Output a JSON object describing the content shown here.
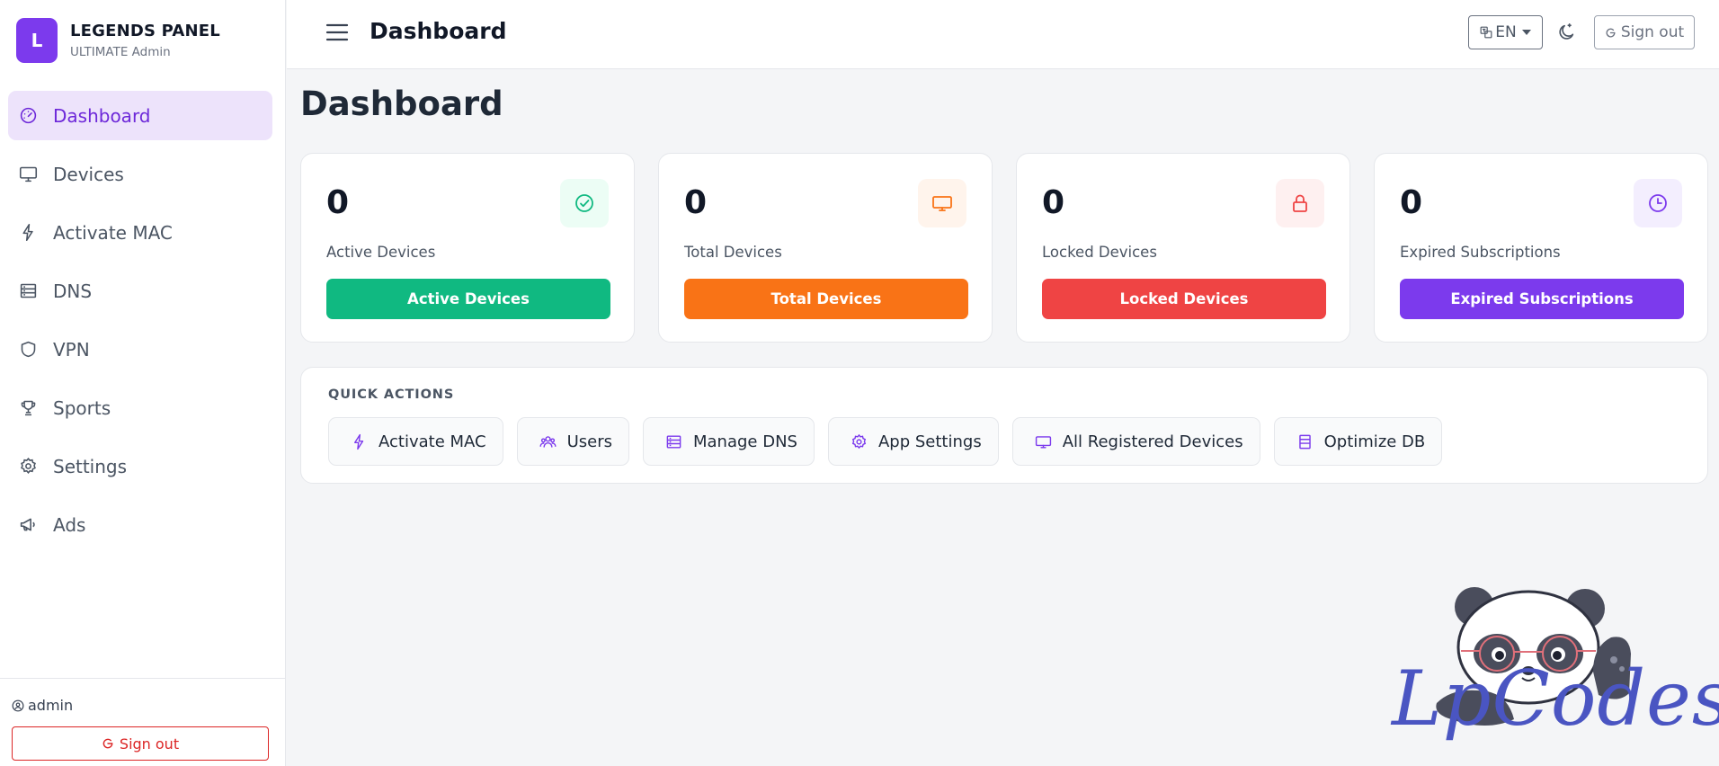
{
  "brand": {
    "logo_letter": "L",
    "name": "LEGENDS PANEL",
    "subtitle": "ULTIMATE Admin"
  },
  "sidebar": {
    "items": [
      {
        "label": "Dashboard",
        "icon": "gauge-icon",
        "active": true
      },
      {
        "label": "Devices",
        "icon": "monitor-icon"
      },
      {
        "label": "Activate MAC",
        "icon": "bolt-icon"
      },
      {
        "label": "DNS",
        "icon": "server-icon"
      },
      {
        "label": "VPN",
        "icon": "shield-icon"
      },
      {
        "label": "Sports",
        "icon": "trophy-icon"
      },
      {
        "label": "Settings",
        "icon": "gear-icon"
      },
      {
        "label": "Ads",
        "icon": "megaphone-icon"
      }
    ],
    "user": "admin",
    "signout_label": "Sign out"
  },
  "topbar": {
    "title": "Dashboard",
    "language": "EN",
    "signout_label": "Sign out"
  },
  "main": {
    "title": "Dashboard",
    "stats": [
      {
        "value": "0",
        "label": "Active Devices",
        "button": "Active Devices",
        "icon": "check-circle-icon",
        "color": "#10b981",
        "tint": "#ecfdf5"
      },
      {
        "value": "0",
        "label": "Total Devices",
        "button": "Total Devices",
        "icon": "monitor-icon",
        "color": "#f97316",
        "tint": "#fff4ec"
      },
      {
        "value": "0",
        "label": "Locked Devices",
        "button": "Locked Devices",
        "icon": "lock-icon",
        "color": "#ef4444",
        "tint": "#fef0f0"
      },
      {
        "value": "0",
        "label": "Expired Subscriptions",
        "button": "Expired Subscriptions",
        "icon": "clock-icon",
        "color": "#7c3aed",
        "tint": "#f3eefe"
      }
    ],
    "quick_actions": {
      "title": "QUICK ACTIONS",
      "items": [
        {
          "label": "Activate MAC",
          "icon": "bolt-icon"
        },
        {
          "label": "Users",
          "icon": "users-icon"
        },
        {
          "label": "Manage DNS",
          "icon": "server-icon"
        },
        {
          "label": "App Settings",
          "icon": "gear-icon"
        },
        {
          "label": "All Registered Devices",
          "icon": "monitor-icon"
        },
        {
          "label": "Optimize DB",
          "icon": "database-icon"
        }
      ]
    }
  },
  "watermark": {
    "text": "LpCodes"
  },
  "colors": {
    "accent": "#7c3aed",
    "active_bg": "#ede3fb",
    "danger": "#dc2626"
  }
}
